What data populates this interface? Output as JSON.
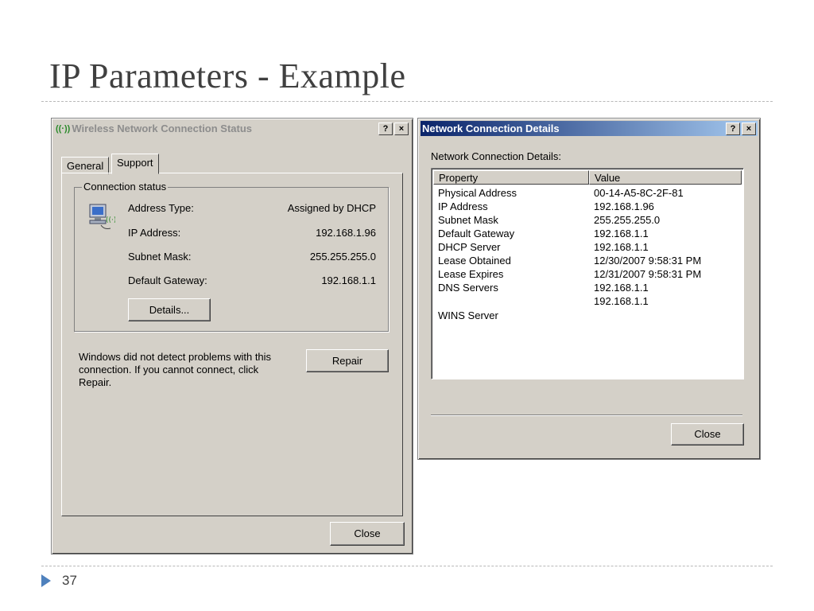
{
  "slide": {
    "title": "IP Parameters - Example",
    "page_number": "37"
  },
  "status_window": {
    "title": "Wireless Network Connection Status",
    "help_button": "?",
    "close_x": "×",
    "tabs": [
      "General",
      "Support"
    ],
    "active_tab": "Support",
    "group_label": "Connection status",
    "rows": [
      {
        "label": "Address Type:",
        "value": "Assigned by DHCP"
      },
      {
        "label": "IP Address:",
        "value": "192.168.1.96"
      },
      {
        "label": "Subnet Mask:",
        "value": "255.255.255.0"
      },
      {
        "label": "Default Gateway:",
        "value": "192.168.1.1"
      }
    ],
    "details_button": "Details...",
    "message": "Windows did not detect problems with this connection. If you cannot connect, click Repair.",
    "repair_button": "Repair",
    "close_button": "Close"
  },
  "details_window": {
    "title": "Network Connection Details",
    "help_button": "?",
    "close_x": "×",
    "caption": "Network Connection Details:",
    "columns": [
      "Property",
      "Value"
    ],
    "rows": [
      [
        "Physical Address",
        "00-14-A5-8C-2F-81"
      ],
      [
        "IP Address",
        "192.168.1.96"
      ],
      [
        "Subnet Mask",
        "255.255.255.0"
      ],
      [
        "Default Gateway",
        "192.168.1.1"
      ],
      [
        "DHCP Server",
        "192.168.1.1"
      ],
      [
        "Lease Obtained",
        "12/30/2007 9:58:31 PM"
      ],
      [
        "Lease Expires",
        "12/31/2007 9:58:31 PM"
      ],
      [
        "DNS Servers",
        "192.168.1.1"
      ],
      [
        "",
        "192.168.1.1"
      ],
      [
        "WINS Server",
        ""
      ]
    ],
    "close_button": "Close"
  }
}
